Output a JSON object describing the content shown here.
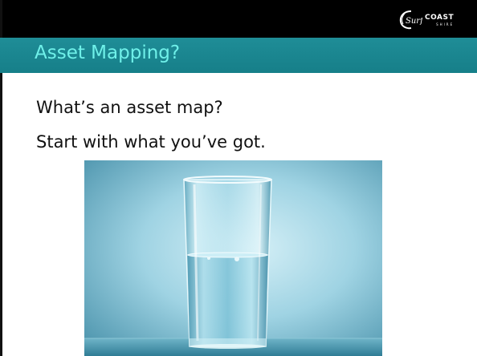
{
  "logo": {
    "script": "Surf",
    "main": "COAST",
    "sub": "SHIRE"
  },
  "slide": {
    "title": "Asset Mapping?",
    "bullets": [
      "What’s an asset map?",
      "Start with what you’ve got."
    ]
  },
  "image": {
    "subject": "glass half full of water"
  },
  "colors": {
    "title_band": "#167f89",
    "title_text": "#6ff0e9",
    "top_band": "#000000"
  }
}
